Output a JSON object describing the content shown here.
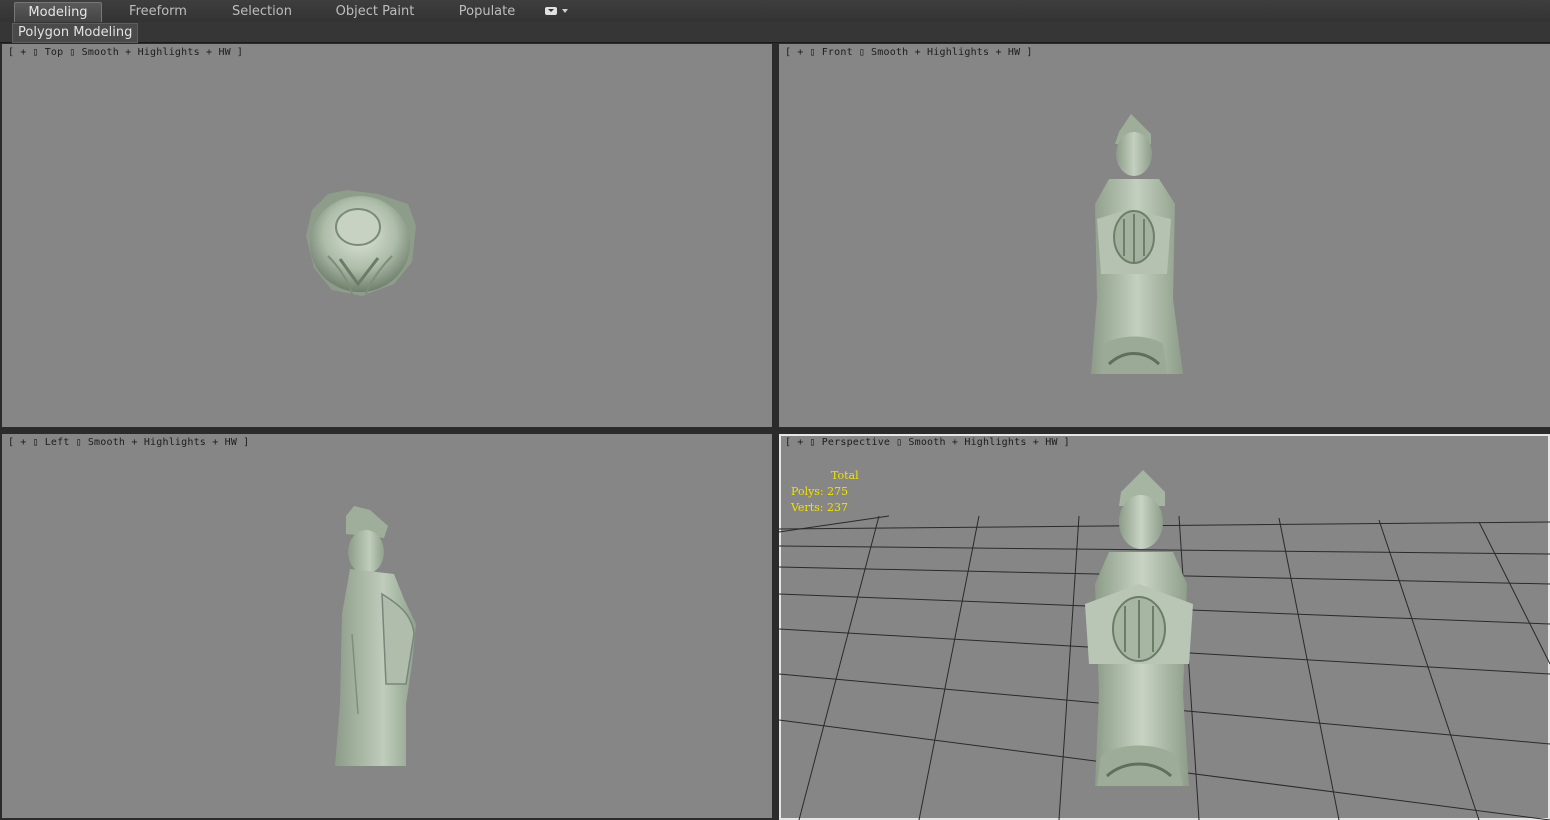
{
  "ribbon": {
    "tabs": [
      "Modeling",
      "Freeform",
      "Selection",
      "Object Paint",
      "Populate"
    ],
    "active_tab": "Modeling"
  },
  "panel": {
    "label": "Polygon Modeling"
  },
  "viewports": {
    "top": {
      "plus": "+",
      "view": "Top",
      "shading": "Smooth + Highlights + HW"
    },
    "front": {
      "plus": "+",
      "view": "Front",
      "shading": "Smooth + Highlights + HW"
    },
    "left": {
      "plus": "+",
      "view": "Left",
      "shading": "Smooth + Highlights + HW"
    },
    "persp": {
      "plus": "+",
      "view": "Perspective",
      "shading": "Smooth + Highlights + HW"
    }
  },
  "stats": {
    "title": "Total",
    "polys_label": "Polys:",
    "polys": "275",
    "verts_label": "Verts:",
    "verts": "237"
  },
  "colors": {
    "viewport_bg": "#868686",
    "statue": "#a9b8a6",
    "stats_text": "#f2e100"
  }
}
